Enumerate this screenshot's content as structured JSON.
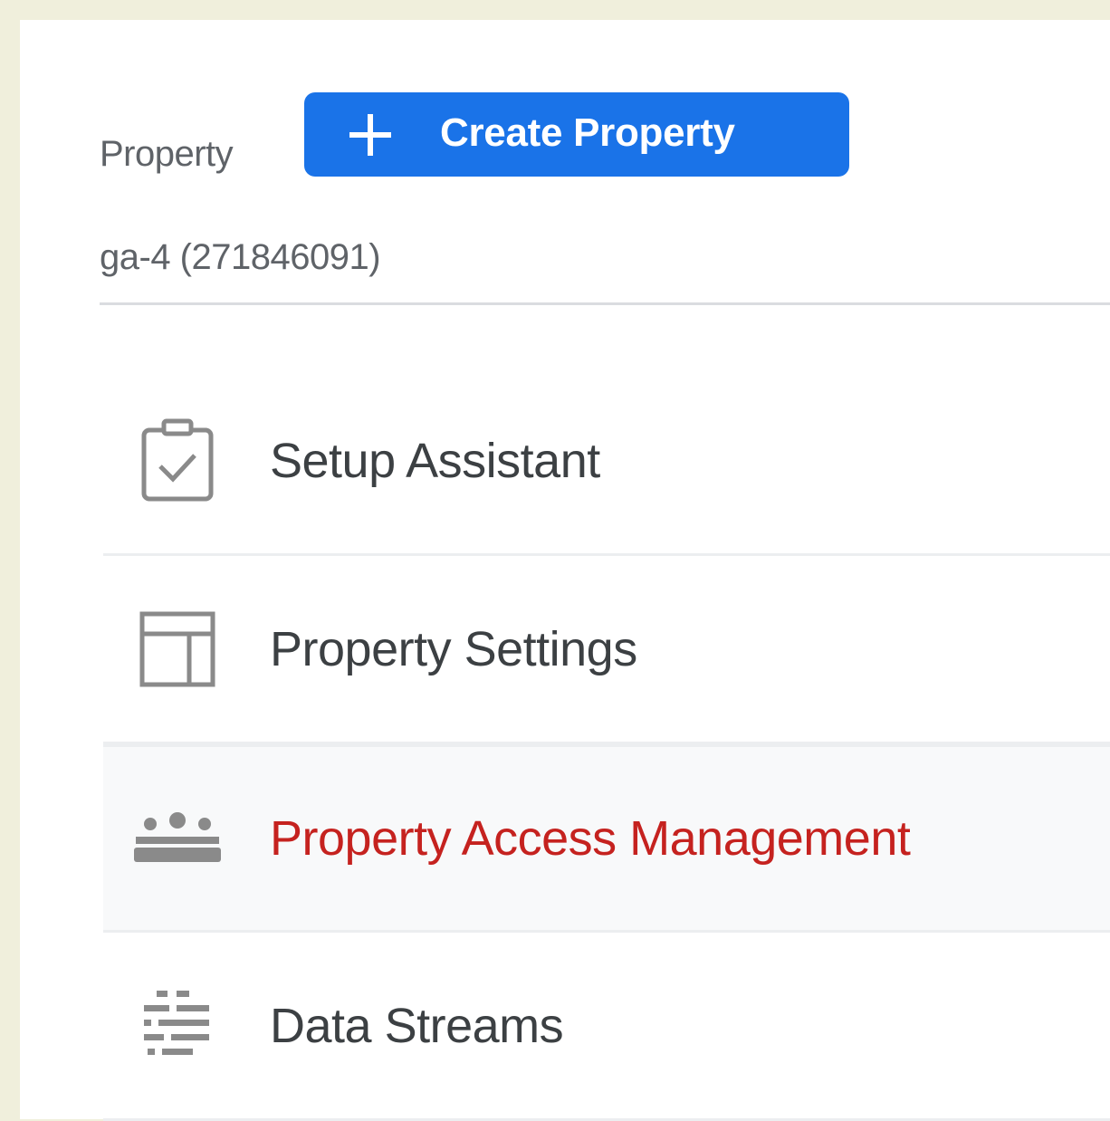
{
  "property_header": {
    "label": "Property",
    "create_button": {
      "label": "Create Property",
      "icon": "plus-icon",
      "color": "#1a73e8"
    },
    "selected_property": "ga-4 (271846091)"
  },
  "menu": {
    "items": [
      {
        "label": "Setup Assistant",
        "icon": "clipboard-check-icon",
        "active": false
      },
      {
        "label": "Property Settings",
        "icon": "property-layout-icon",
        "active": false
      },
      {
        "label": "Property Access Management",
        "icon": "people-group-icon",
        "active": true
      },
      {
        "label": "Data Streams",
        "icon": "data-streams-icon",
        "active": false
      }
    ]
  },
  "colors": {
    "page_background": "#f0efdc",
    "panel_background": "#ffffff",
    "active_row_background": "#f8f9fa",
    "active_text": "#c5221f",
    "icon_gray": "#8a8a8a",
    "text": "#3c4043"
  }
}
